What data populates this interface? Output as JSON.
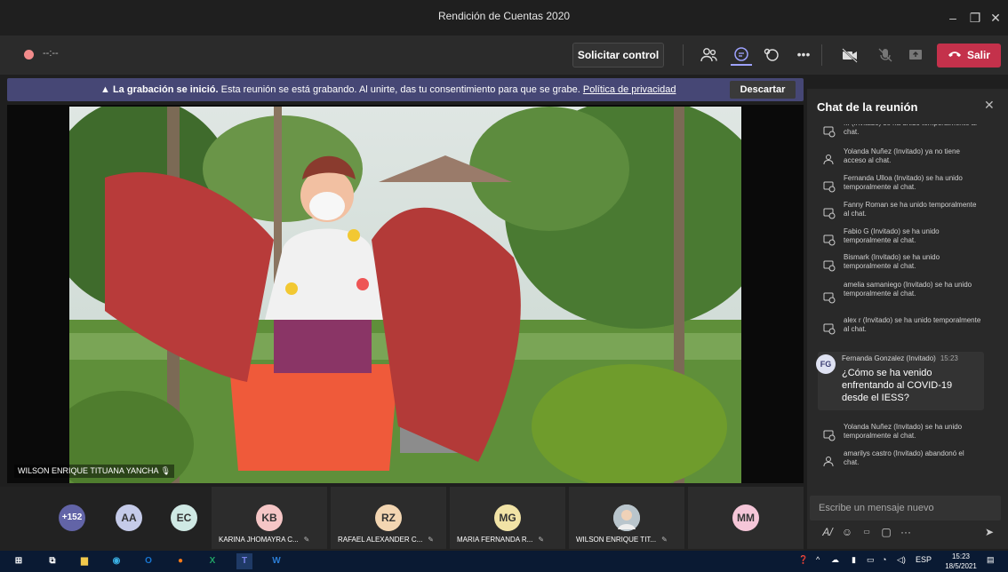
{
  "window": {
    "title": "Rendición de Cuentas 2020"
  },
  "toolbar": {
    "recording_time": "--:--",
    "request_control": "Solicitar control",
    "leave": "Salir",
    "icons": [
      "participants-icon",
      "chat-icon",
      "reactions-icon",
      "more-icon",
      "camera-off-icon",
      "mic-off-icon",
      "share-icon"
    ]
  },
  "banner": {
    "title": "La grabación se inició.",
    "text": "Esta reunión se está grabando. Al unirte, das tu consentimiento para que se grabe.",
    "link": "Política de privacidad",
    "dismiss": "Descartar"
  },
  "video": {
    "speaker": "WILSON ENRIQUE TITUANA YANCHA"
  },
  "chat": {
    "title": "Chat de la reunión",
    "events": [
      {
        "icon": "joined-icon",
        "text": "... (Invitado) se ha unido temporalmente al chat."
      },
      {
        "icon": "left-icon",
        "text": "Yolanda Nuñez (Invitado) ya no tiene acceso al chat."
      },
      {
        "icon": "joined-icon",
        "text": "Fernanda Ulloa (Invitado) se ha unido temporalmente al chat."
      },
      {
        "icon": "joined-icon",
        "text": "Fanny Roman se ha unido temporalmente al chat."
      },
      {
        "icon": "joined-icon",
        "text": "Fabio G (Invitado) se ha unido temporalmente al chat."
      },
      {
        "icon": "joined-icon",
        "text": "Bismark (Invitado) se ha unido temporalmente al chat."
      },
      {
        "icon": "joined-icon",
        "text": "amelia samaniego (Invitado) se ha unido temporalmente al chat."
      },
      {
        "icon": "joined-icon",
        "text": "alex r (Invitado) se ha unido temporalmente al chat."
      }
    ],
    "message": {
      "initials": "FG",
      "author": "Fernanda Gonzalez (Invitado)",
      "time": "15:23",
      "body": "¿Cómo se ha venido enfrentando al COVID-19 desde el IESS?"
    },
    "events_after": [
      {
        "icon": "joined-icon",
        "text": "Yolanda Nuñez (Invitado) se ha unido temporalmente al chat."
      },
      {
        "icon": "left-icon",
        "text": "amarilys castro (Invitado) abandonó el chat."
      }
    ],
    "compose_placeholder": "Escribe un mensaje nuevo",
    "compose_tools": [
      "format-icon",
      "emoji-icon",
      "gif-icon",
      "sticker-icon",
      "more-options-icon",
      "send-icon"
    ]
  },
  "roster": {
    "overflow": "+152",
    "avatars": [
      {
        "initials": "AA",
        "color": "#c5cbe9"
      },
      {
        "initials": "EC",
        "color": "#cfe9e4"
      }
    ],
    "tiles": [
      {
        "initials": "KB",
        "name": "KARINA JHOMAYRA C...",
        "color": "#f5c6c6"
      },
      {
        "initials": "RZ",
        "name": "RAFAEL ALEXANDER C...",
        "color": "#f3d6b2"
      },
      {
        "initials": "MG",
        "name": "MARIA FERNANDA R...",
        "color": "#f1e3a6"
      },
      {
        "initials": "",
        "name": "WILSON ENRIQUE TIT...",
        "color": "#cfd8dc"
      },
      {
        "initials": "MM",
        "name": "",
        "color": "#f5c6d8"
      }
    ]
  },
  "taskbar": {
    "apps": [
      "windows-icon",
      "task-view-icon",
      "file-explorer-icon",
      "edge-icon",
      "outlook-icon",
      "firefox-icon",
      "excel-icon",
      "teams-icon",
      "word-icon"
    ],
    "language": "ESP",
    "time": "15:23",
    "date": "18/5/2021"
  },
  "colors": {
    "accent": "#464775",
    "leave": "#c4314b",
    "bg": "#1f1f1f"
  }
}
